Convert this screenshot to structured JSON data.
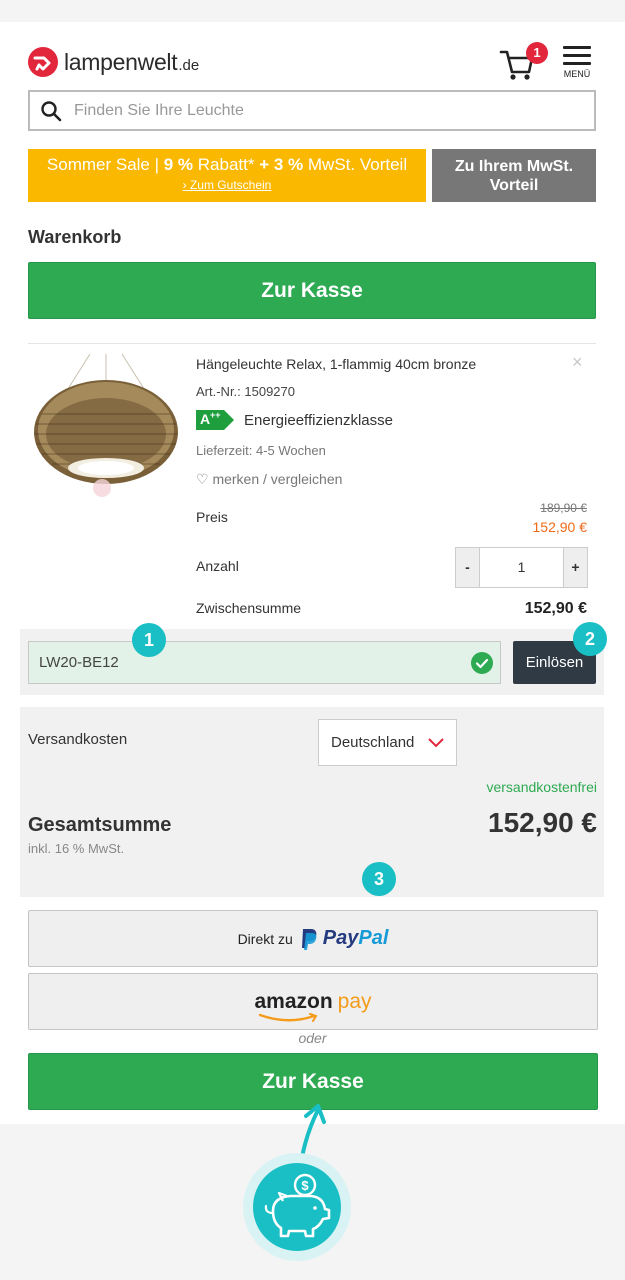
{
  "header": {
    "logo_text": "lampenwelt",
    "logo_tld": ".de",
    "cart_count": "1",
    "menu_label": "MENÜ"
  },
  "search": {
    "placeholder": "Finden Sie Ihre Leuchte"
  },
  "promo": {
    "line_start": "Sommer Sale | ",
    "pct1": "9 %",
    "mid1": " Rabatt* ",
    "plus": "+",
    "pct2": " 3 %",
    "mid2": " MwSt. Vorteil",
    "link": "› Zum Gutschein",
    "vat_box": "Zu Ihrem MwSt. Vorteil"
  },
  "cart": {
    "title": "Warenkorb",
    "checkout_label": "Zur Kasse"
  },
  "product": {
    "name": "Hängeleuchte Relax, 1-flammig 40cm bronze",
    "remove_icon": "×",
    "art_nr": "Art.-Nr.: 1509270",
    "energy_class": "A",
    "energy_sup": "++",
    "energy_label": "Energieeffizienzklasse",
    "lead_time": "Lieferzeit: 4-5 Wochen",
    "wishlist": "♡ merken / vergleichen",
    "price_label": "Preis",
    "price_old": "189,90 €",
    "price_new": "152,90 €",
    "qty_label": "Anzahl",
    "qty_minus": "-",
    "qty_value": "1",
    "qty_plus": "+",
    "subtotal_label": "Zwischensumme",
    "subtotal": "152,90 €"
  },
  "coupon": {
    "value": "LW20-BE12",
    "redeem_label": "Einlösen"
  },
  "shipping": {
    "label": "Versandkosten",
    "country": "Deutschland",
    "cost": "versandkostenfrei"
  },
  "total": {
    "label": "Gesamtsumme",
    "value": "152,90 €",
    "vat_note": "inkl. 16 % MwSt."
  },
  "payments": {
    "paypal_prefix": "Direkt zu",
    "paypal_pay": "Pay",
    "paypal_pal": "Pal",
    "amazon_word": "amazon",
    "amazon_pay": "pay",
    "or": "oder",
    "checkout_label": "Zur Kasse"
  },
  "annotations": {
    "m1": "1",
    "m2": "2",
    "m3": "3"
  },
  "colors": {
    "brand_red": "#e2263c",
    "green": "#2eaa52",
    "promo_yellow": "#fbb800",
    "teal": "#19bfc4",
    "sale_orange": "#f06a1b"
  }
}
